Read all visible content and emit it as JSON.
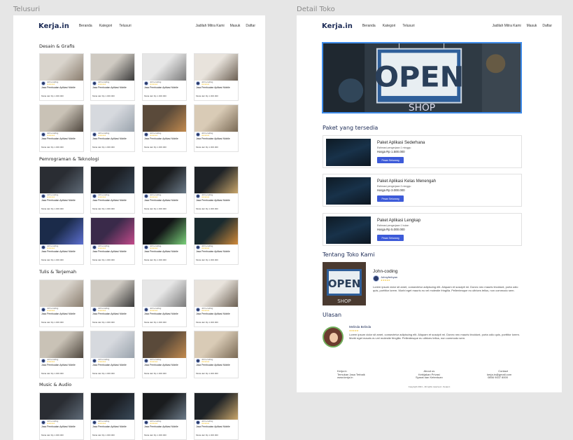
{
  "frames": {
    "telusuri_label": "Telusuri",
    "detail_label": "Detail Toko"
  },
  "nav": {
    "brand": "Kerja.in",
    "links": [
      "Beranda",
      "Kategori",
      "Telusuri"
    ],
    "right": [
      "Jadilah Mitra Kami",
      "Masuk",
      "Daftar"
    ]
  },
  "browse": {
    "sections": [
      {
        "title": "Desain & Grafis"
      },
      {
        "title": "Pemrograman & Teknologi"
      },
      {
        "title": "Tulis & Terjemah"
      },
      {
        "title": "Music & Audio"
      }
    ],
    "card": {
      "seller": "John-coding",
      "stars": "★★★★★",
      "title": "Jasa Pembuatan Aplikasi Mobile",
      "price": "Mulai dari Rp 1.000.000"
    }
  },
  "detail": {
    "paket_title": "Paket yang tersedia",
    "paket": [
      {
        "name": "Paket Aplikasi Sederhana",
        "desc": "Estimasi pengerjaan 1 minggu",
        "price": "Harga Rp 1.500.000",
        "button": "Pesan Sekarang"
      },
      {
        "name": "Paket Aplikasi Kelas Menengah",
        "desc": "Estimasi pengerjaan 3 minggu",
        "price": "Harga Rp 3.000.000",
        "button": "Pesan Sekarang"
      },
      {
        "name": "Paket Aplikasi Lengkap",
        "desc": "Estimasi pengerjaan 1 bulan",
        "price": "Harga Rp 5.000.000",
        "button": "Pesan Sekarang"
      }
    ],
    "tentang_title": "Tentang Toko Kami",
    "store_name": "John-coding",
    "owner": "Johnyferbyan",
    "owner_stars": "★★★★★",
    "about": "Lorem ipsum dolor sit amet, consectetur adipiscing elit. Aliquam et suscipit mi. Donec nec mauris tincidunt, porta odio quis, porttitor lorem. Morbi eget mauris eu vel molestie fringilla. Pellentesque eu ultrices tellus, non commodo sem.",
    "ulasan_title": "Ulasan",
    "reviewer": "Melinda Belinda",
    "reviewer_stars": "★★★★★",
    "review": "Lorem ipsum dolor sit amet, consectetur adipiscing elit. Aliquam et suscipit mi. Donec nec mauris tincidunt, porta odio quis, porttitor lorem. Morbi eget mauris eu vel molestie fringilla. Pellentesque eu ultrices tellus, non commodo sem.",
    "footer": {
      "col1": [
        "Kerja.in",
        "Temukan Jasa Terbaik",
        "www.kerja.in"
      ],
      "col2": [
        "About us",
        "Kebijakan Privasi",
        "Syarat dan Ketentuan"
      ],
      "col3": [
        "Contact",
        "kerja.in@gmail.com",
        "0856 9437 8000"
      ],
      "copyright": "Copyright 2021 - All rights reserved - Kerja.in"
    }
  },
  "colors": {
    "accent": "#3d5bd9",
    "brand": "#1b2a55",
    "hero_border": "#3f8cea"
  }
}
